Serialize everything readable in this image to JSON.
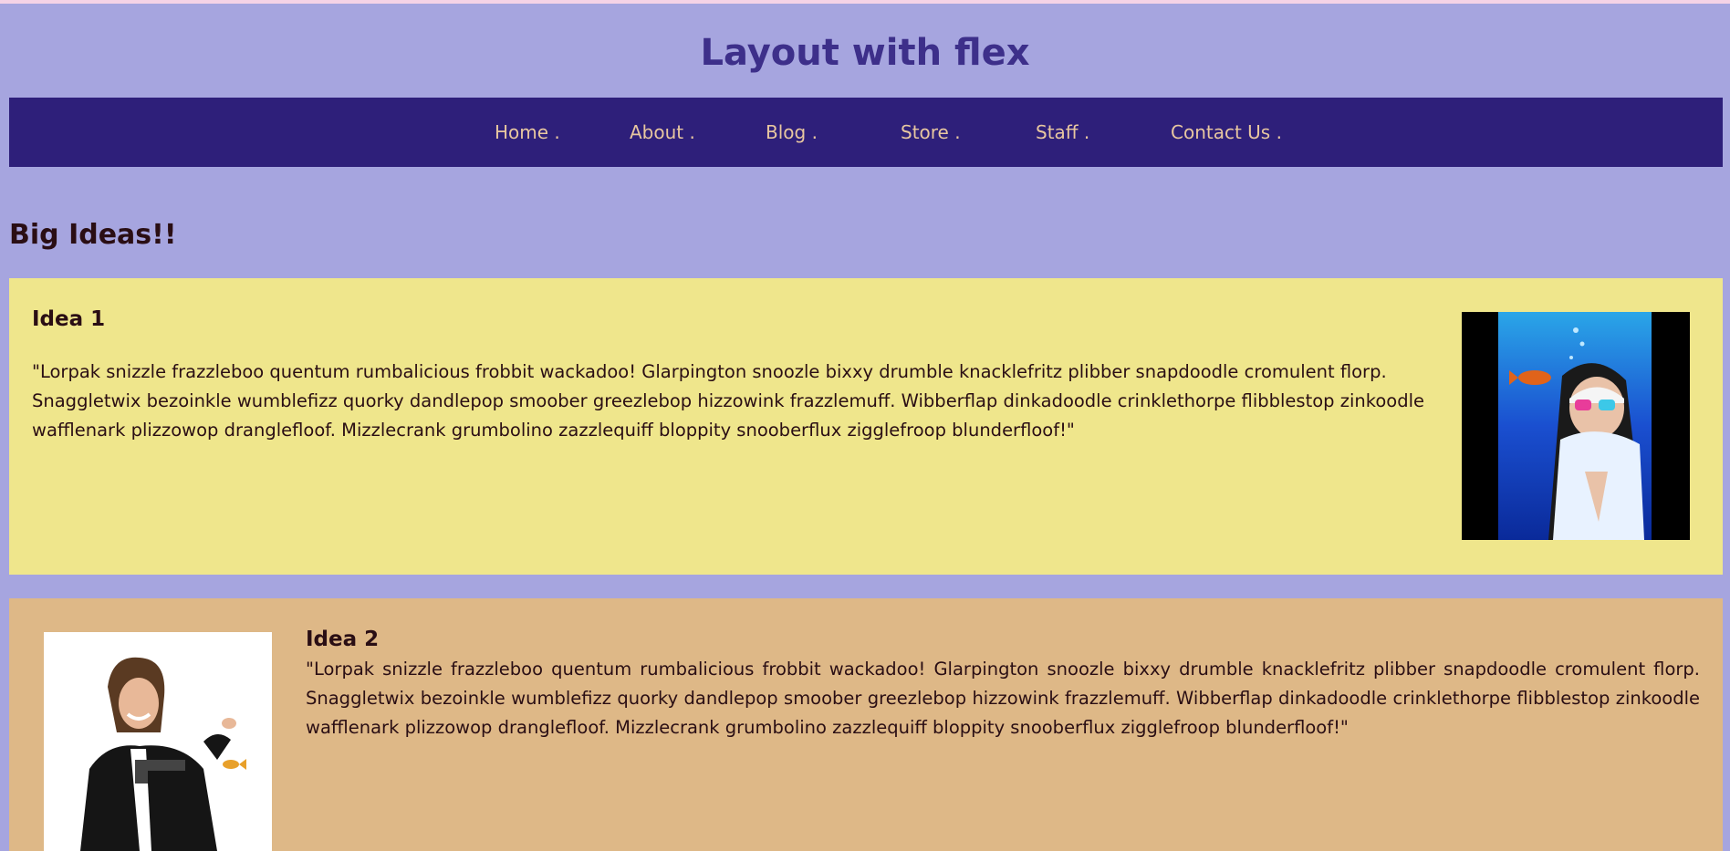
{
  "page": {
    "title": "Layout with flex"
  },
  "nav": {
    "items": [
      {
        "label": "Home ."
      },
      {
        "label": "About ."
      },
      {
        "label": "Blog ."
      },
      {
        "label": "Store ."
      },
      {
        "label": "Staff ."
      },
      {
        "label": "Contact Us ."
      }
    ]
  },
  "section": {
    "heading": "Big Ideas!!"
  },
  "ideas": [
    {
      "title": "Idea 1",
      "text": "\"Lorpak snizzle frazzleboo quentum rumbalicious frobbit wackadoo! Glarpington snoozle bixxy drumble knacklefritz plibber snapdoodle cromulent florp. Snaggletwix bezoinkle wumblefizz quorky dandlepop smoober greezlebop hizzowink frazzlemuff. Wibberflap dinkadoodle crinklethorpe flibblestop zinkoodle wafflenark plizzowop dranglefloof. Mizzlecrank grumbolino zazzlequiff bloppity snooberflux zigglefroop blunderfloof!\"",
      "image": "underwater-nun-photo"
    },
    {
      "title": "Idea 2",
      "text": "\"Lorpak snizzle frazzleboo quentum rumbalicious frobbit wackadoo! Glarpington snoozle bixxy drumble knacklefritz plibber snapdoodle cromulent florp. Snaggletwix bezoinkle wumblefizz quorky dandlepop smoober greezlebop hizzowink frazzlemuff. Wibberflap dinkadoodle crinklethorpe flibblestop zinkoodle wafflenark plizzowop dranglefloof. Mizzlecrank grumbolino zazzlequiff bloppity snooberflux zigglefroop blunderfloof!\"",
      "image": "woman-with-pistol-and-goldfish-photo"
    }
  ],
  "colors": {
    "background": "#a6a5df",
    "top_strip": "#f5d3e6",
    "title": "#3d2f8a",
    "navbar": "#2e1f7a",
    "nav_text": "#e8c7a0",
    "card1": "#efe68c",
    "card2": "#deb887",
    "body_text": "#2a0e14"
  }
}
